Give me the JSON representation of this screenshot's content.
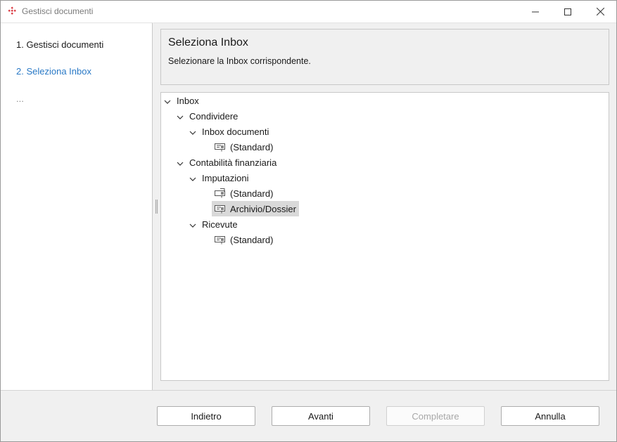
{
  "window": {
    "title": "Gestisci documenti"
  },
  "steps": [
    {
      "label": "1. Gestisci documenti"
    },
    {
      "label": "2. Seleziona Inbox"
    },
    {
      "label": "..."
    }
  ],
  "header": {
    "title": "Seleziona Inbox",
    "subtitle": "Selezionare la Inbox corrispondente."
  },
  "tree": {
    "root": "Inbox",
    "groups": [
      {
        "label": "Condividere",
        "children": [
          {
            "label": "Inbox documenti",
            "leaves": [
              "(Standard)"
            ]
          }
        ]
      },
      {
        "label": "Contabilità finanziaria",
        "children": [
          {
            "label": "Imputazioni",
            "leaves": [
              "(Standard)",
              "Archivio/Dossier"
            ]
          },
          {
            "label": "Ricevute",
            "leaves": [
              "(Standard)"
            ]
          }
        ]
      }
    ],
    "selected": "Archivio/Dossier"
  },
  "buttons": {
    "back": "Indietro",
    "next": "Avanti",
    "finish": "Completare",
    "cancel": "Annulla"
  },
  "colors": {
    "active_step": "#2979c6",
    "selected_row": "#d9d9d9",
    "app_icon": "#d9363e"
  },
  "icons": {
    "app": "app-logo-icon",
    "minimize": "minimize-icon",
    "maximize": "maximize-icon",
    "close": "close-icon",
    "expand": "chevron-down-icon",
    "inbox": "inbox-tray-icon"
  }
}
